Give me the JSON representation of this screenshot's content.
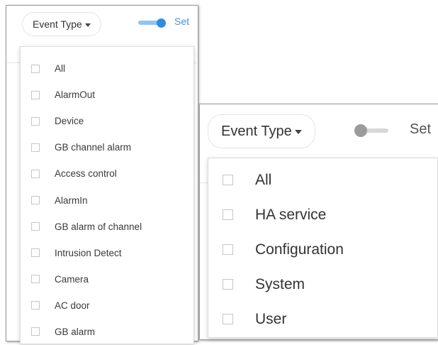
{
  "left_panel": {
    "event_type_label": "Event Type",
    "toggle_on": true,
    "set_label_clipped": "Set",
    "options": [
      "All",
      "AlarmOut",
      "Device",
      "GB channel alarm",
      "Access control",
      "AlarmIn",
      "GB alarm of channel",
      "Intrusion Detect",
      "Camera",
      "AC door",
      "GB alarm"
    ]
  },
  "right_panel": {
    "event_type_label": "Event Type",
    "toggle_on": false,
    "set_label_clipped": "Set",
    "options": [
      "All",
      "HA service",
      "Configuration",
      "System",
      "User"
    ]
  },
  "colors": {
    "toggle_on_track": "#8dc6ef",
    "toggle_on_knob": "#2f8ee0",
    "toggle_off_track": "#d7d7d7",
    "toggle_off_knob": "#9b9b9b",
    "set_link": "#4a90d9"
  }
}
